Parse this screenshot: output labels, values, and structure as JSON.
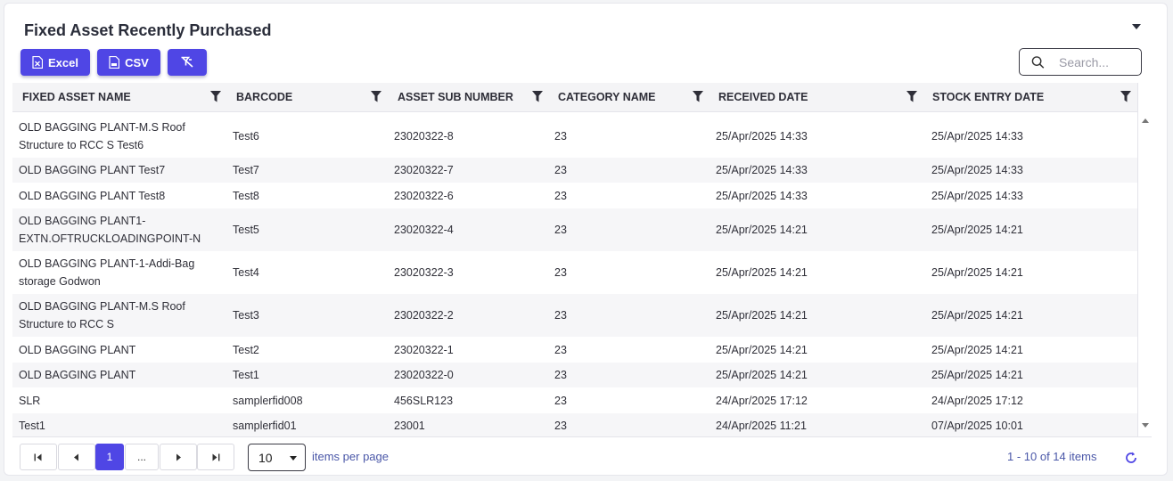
{
  "title": "Fixed Asset Recently Purchased",
  "toolbar": {
    "excel_label": "Excel",
    "csv_label": "CSV"
  },
  "search": {
    "placeholder": "Search..."
  },
  "columns": [
    "FIXED ASSET NAME",
    "BARCODE",
    "ASSET SUB NUMBER",
    "CATEGORY NAME",
    "RECEIVED DATE",
    "STOCK ENTRY DATE"
  ],
  "rows": [
    {
      "name": "OLD BAGGING PLANT-M.S Roof Structure to RCC S Test6",
      "barcode": "Test6",
      "sub": "23020322-8",
      "category": "23",
      "received": "25/Apr/2025 14:33",
      "stock": "25/Apr/2025 14:33"
    },
    {
      "name": "OLD BAGGING PLANT Test7",
      "barcode": "Test7",
      "sub": "23020322-7",
      "category": "23",
      "received": "25/Apr/2025 14:33",
      "stock": "25/Apr/2025 14:33"
    },
    {
      "name": "OLD BAGGING PLANT Test8",
      "barcode": "Test8",
      "sub": "23020322-6",
      "category": "23",
      "received": "25/Apr/2025 14:33",
      "stock": "25/Apr/2025 14:33"
    },
    {
      "name": "OLD BAGGING PLANT1-EXTN.OFTRUCKLOADINGPOINT-N",
      "barcode": "Test5",
      "sub": "23020322-4",
      "category": "23",
      "received": "25/Apr/2025 14:21",
      "stock": "25/Apr/2025 14:21"
    },
    {
      "name": "OLD BAGGING PLANT-1-Addi-Bag storage Godwon",
      "barcode": "Test4",
      "sub": "23020322-3",
      "category": "23",
      "received": "25/Apr/2025 14:21",
      "stock": "25/Apr/2025 14:21"
    },
    {
      "name": "OLD BAGGING PLANT-M.S Roof Structure to RCC S",
      "barcode": "Test3",
      "sub": "23020322-2",
      "category": "23",
      "received": "25/Apr/2025 14:21",
      "stock": "25/Apr/2025 14:21"
    },
    {
      "name": "OLD BAGGING PLANT",
      "barcode": "Test2",
      "sub": "23020322-1",
      "category": "23",
      "received": "25/Apr/2025 14:21",
      "stock": "25/Apr/2025 14:21"
    },
    {
      "name": "OLD BAGGING PLANT",
      "barcode": "Test1",
      "sub": "23020322-0",
      "category": "23",
      "received": "25/Apr/2025 14:21",
      "stock": "25/Apr/2025 14:21"
    },
    {
      "name": "SLR",
      "barcode": "samplerfid008",
      "sub": "456SLR123",
      "category": "23",
      "received": "24/Apr/2025 17:12",
      "stock": "24/Apr/2025 17:12"
    },
    {
      "name": "Test1",
      "barcode": "samplerfid01",
      "sub": "23001",
      "category": "23",
      "received": "24/Apr/2025 11:21",
      "stock": "07/Apr/2025 10:01"
    }
  ],
  "pager": {
    "current_page": "1",
    "ellipsis": "...",
    "page_size": "10",
    "items_per_page_label": "items per page",
    "info": "1 - 10 of 14 items"
  }
}
